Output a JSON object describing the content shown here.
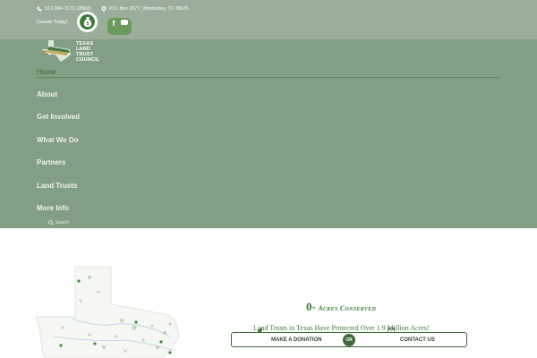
{
  "topbar": {
    "phone": "512-994-TLTC (8582)",
    "address": "P.O. Box 2677, Wimberley, TX 78676",
    "donate_text": "Donate Today!",
    "facebook_glyph": "f"
  },
  "logo": {
    "line1": "TEXAS",
    "line2": "LAND TRUST",
    "line3": "COUNCIL"
  },
  "nav": {
    "items": [
      "Home",
      "About",
      "Get Involved",
      "What We Do",
      "Partners",
      "Land Trusts",
      "More Info"
    ],
    "search_label": "Search"
  },
  "stats": {
    "acres_value": "0",
    "acres_label": "+ Acres Conserved",
    "tagline": "Land Trusts in Texas Have Protected Over 1.9 Million Acres!"
  },
  "cta": {
    "donate_label": "MAKE A DONATION",
    "or_label": "OR",
    "contact_label": "CONTACT US"
  },
  "colors": {
    "topbar": "#9aae9b",
    "nav_panel": "#829e84",
    "accent_green": "#3f7a3c"
  },
  "icons": {
    "phone": "phone-icon",
    "location": "location-pin-icon",
    "donate": "money-bag-icon",
    "facebook": "facebook-icon",
    "youtube": "youtube-icon",
    "search": "search-icon",
    "leaf": "leaf-icon",
    "mail": "mail-icon"
  }
}
